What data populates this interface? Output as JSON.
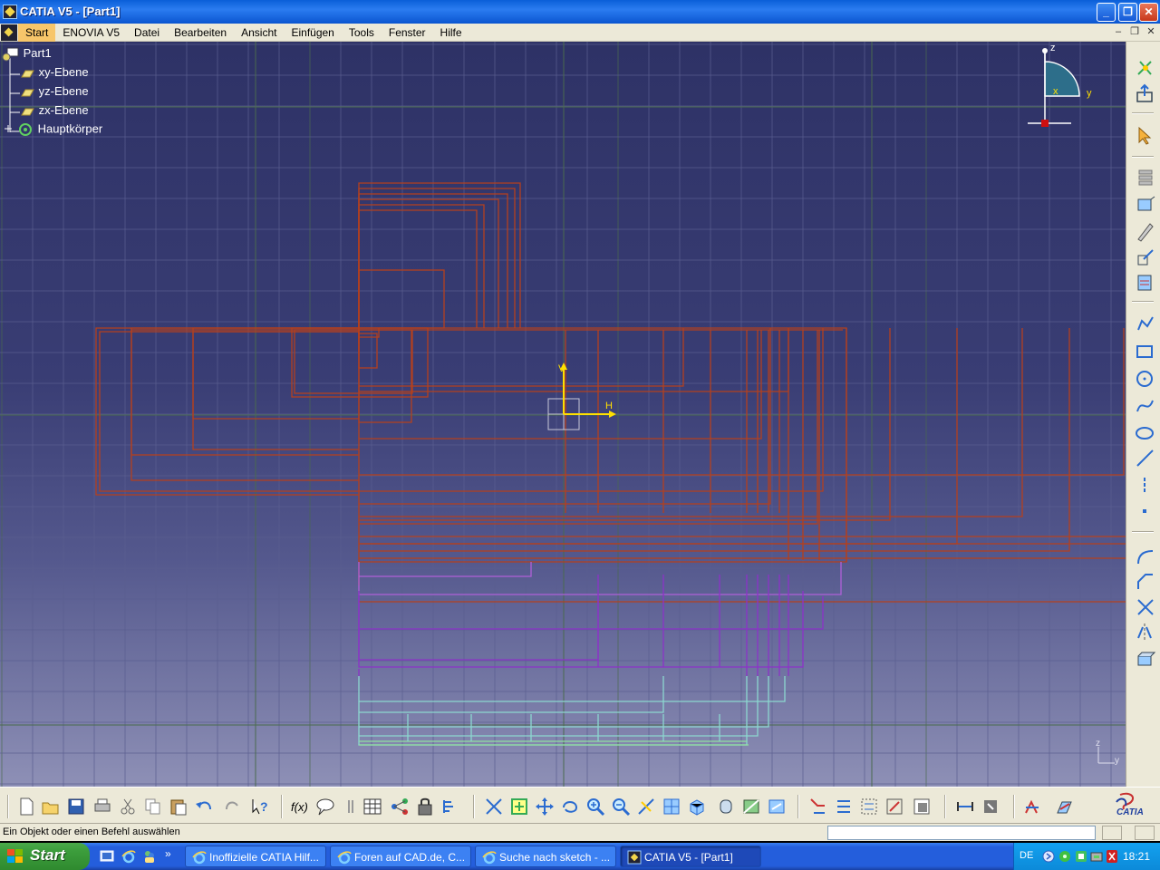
{
  "window": {
    "title": "CATIA V5 - [Part1]",
    "minimize": "_",
    "maximize": "❐",
    "close": "✕"
  },
  "menu": {
    "items": [
      "Start",
      "ENOVIA V5",
      "Datei",
      "Bearbeiten",
      "Ansicht",
      "Einfügen",
      "Tools",
      "Fenster",
      "Hilfe"
    ],
    "active_index": 0
  },
  "tree": {
    "root": "Part1",
    "items": [
      "xy-Ebene",
      "yz-Ebene",
      "zx-Ebene",
      "Hauptkörper"
    ]
  },
  "compass": {
    "x_label": "x",
    "y_label": "y",
    "z_label": "z"
  },
  "sketch_axes": {
    "v_label": "V",
    "h_label": "H"
  },
  "mini_axes": {
    "z_label": "z",
    "y_label": "y"
  },
  "colors": {
    "sketch_red": "#b4401e",
    "sketch_purple_light": "#b060d8",
    "sketch_purple": "#8c32c8",
    "sketch_cyan": "#8cd8d0",
    "sketch_green": "#90e0a0",
    "axis_yellow": "#ffe000",
    "grid": "#5a5e90"
  },
  "statusbar": {
    "message": "Ein Objekt oder einen Befehl auswählen",
    "command_value": ""
  },
  "brand": "CATIA",
  "taskbar": {
    "start": "Start",
    "tasks": [
      {
        "label": "Inoffizielle CATIA Hilf...",
        "active": false
      },
      {
        "label": "Foren auf CAD.de, C...",
        "active": false
      },
      {
        "label": "Suche nach sketch - ...",
        "active": false
      },
      {
        "label": "CATIA V5 - [Part1]",
        "active": true
      }
    ],
    "language": "DE",
    "time": "18:21"
  }
}
